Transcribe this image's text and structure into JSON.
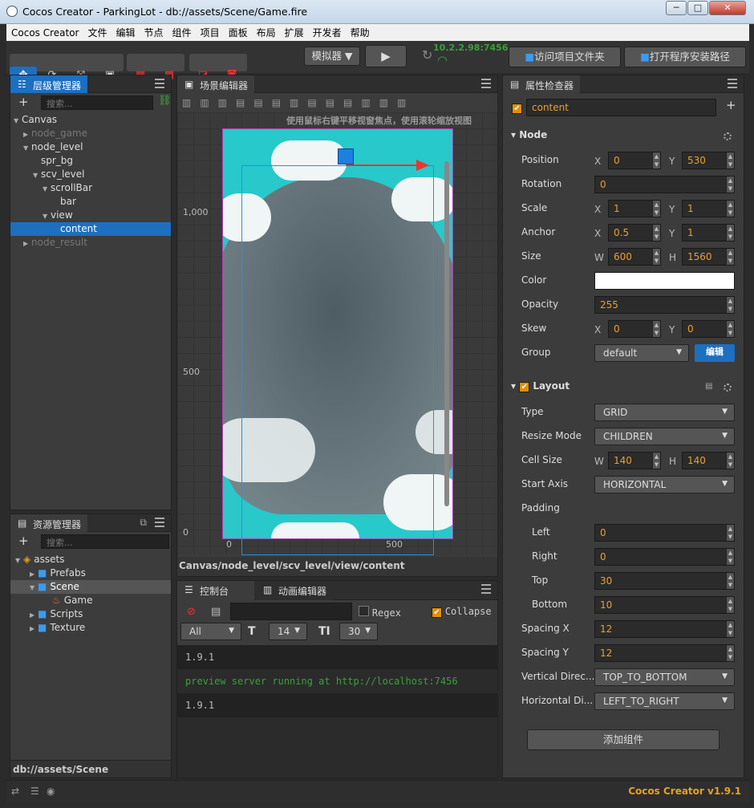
{
  "window": {
    "title": "Cocos Creator - ParkingLot - db://assets/Scene/Game.fire",
    "min": "─",
    "max": "□",
    "close": "✕"
  },
  "menu": [
    "Cocos Creator",
    "文件",
    "编辑",
    "节点",
    "组件",
    "项目",
    "面板",
    "布局",
    "扩展",
    "开发者",
    "帮助"
  ],
  "toolbar": {
    "simulator": "模拟器 ▼",
    "play": "▶",
    "refresh": "↻",
    "ip": "10.2.2.98:7456",
    "open_project": "访问项目文件夹",
    "open_install": "打开程序安装路径"
  },
  "hierarchy": {
    "tab": "层级管理器",
    "add": "+",
    "search_placeholder": "搜索...",
    "nodes": [
      {
        "label": "Canvas",
        "state": "open",
        "depth": 0,
        "dim": false,
        "selected": false
      },
      {
        "label": "node_game",
        "state": "closed",
        "depth": 1,
        "dim": true,
        "selected": false
      },
      {
        "label": "node_level",
        "state": "open",
        "depth": 1,
        "dim": false,
        "selected": false
      },
      {
        "label": "spr_bg",
        "state": "leaf",
        "depth": 2,
        "dim": false,
        "selected": false
      },
      {
        "label": "scv_level",
        "state": "open",
        "depth": 2,
        "dim": false,
        "selected": false
      },
      {
        "label": "scrollBar",
        "state": "open",
        "depth": 3,
        "dim": false,
        "selected": false
      },
      {
        "label": "bar",
        "state": "leaf",
        "depth": 4,
        "dim": false,
        "selected": false
      },
      {
        "label": "view",
        "state": "open",
        "depth": 3,
        "dim": false,
        "selected": false
      },
      {
        "label": "content",
        "state": "leaf",
        "depth": 4,
        "dim": false,
        "selected": true
      },
      {
        "label": "node_result",
        "state": "closed",
        "depth": 1,
        "dim": true,
        "selected": false
      }
    ]
  },
  "assets": {
    "tab": "资源管理器",
    "add": "+",
    "search_placeholder": "搜索...",
    "items": [
      {
        "label": "assets",
        "state": "open",
        "depth": 0,
        "icon": "assets-db-icon",
        "selected": false
      },
      {
        "label": "Prefabs",
        "state": "closed",
        "depth": 1,
        "icon": "folder-icon",
        "selected": false
      },
      {
        "label": "Scene",
        "state": "open",
        "depth": 1,
        "icon": "folder-icon",
        "selected": true
      },
      {
        "label": "Game",
        "state": "leaf",
        "depth": 2,
        "icon": "scene-fire-icon",
        "selected": false
      },
      {
        "label": "Scripts",
        "state": "closed",
        "depth": 1,
        "icon": "folder-icon",
        "selected": false
      },
      {
        "label": "Texture",
        "state": "closed",
        "depth": 1,
        "icon": "folder-icon",
        "selected": false
      }
    ],
    "path": "db://assets/Scene"
  },
  "scene": {
    "tab": "场景编辑器",
    "hint": "使用鼠标右键平移视窗焦点，使用滚轮缩放视图",
    "y_ticks": [
      "1,000",
      "500",
      "0"
    ],
    "x_ticks": [
      "0",
      "500"
    ],
    "breadcrumb": "Canvas/node_level/scv_level/view/content"
  },
  "console": {
    "tabs": [
      "控制台",
      "动画编辑器"
    ],
    "regex": "Regex",
    "collapse": "Collapse",
    "filter": "All",
    "font_size": "14",
    "line_height": "30",
    "lines": [
      {
        "text": "1.9.1",
        "color": "#bbbbbb"
      },
      {
        "text": "preview server running at http://localhost:7456",
        "color": "#3aa03a"
      },
      {
        "text": "1.9.1",
        "color": "#bbbbbb"
      }
    ]
  },
  "inspector": {
    "tab": "属性检查器",
    "name": "content",
    "add": "+",
    "node_section": "Node",
    "position": {
      "label": "Position",
      "x": "0",
      "y": "530"
    },
    "rotation": {
      "label": "Rotation",
      "value": "0"
    },
    "scale": {
      "label": "Scale",
      "x": "1",
      "y": "1"
    },
    "anchor": {
      "label": "Anchor",
      "x": "0.5",
      "y": "1"
    },
    "size": {
      "label": "Size",
      "w": "600",
      "h": "1560"
    },
    "color": {
      "label": "Color",
      "value": "#ffffff"
    },
    "opacity": {
      "label": "Opacity",
      "value": "255"
    },
    "skew": {
      "label": "Skew",
      "x": "0",
      "y": "0"
    },
    "group": {
      "label": "Group",
      "value": "default",
      "edit": "编辑"
    },
    "layout_section": "Layout",
    "type": {
      "label": "Type",
      "value": "GRID"
    },
    "resize_mode": {
      "label": "Resize Mode",
      "value": "CHILDREN"
    },
    "cell_size": {
      "label": "Cell Size",
      "w": "140",
      "h": "140"
    },
    "start_axis": {
      "label": "Start Axis",
      "value": "HORIZONTAL"
    },
    "padding": {
      "label": "Padding",
      "left_label": "Left",
      "left": "0",
      "right_label": "Right",
      "right": "0",
      "top_label": "Top",
      "top": "30",
      "bottom_label": "Bottom",
      "bottom": "10"
    },
    "spacing_x": {
      "label": "Spacing X",
      "value": "12"
    },
    "spacing_y": {
      "label": "Spacing Y",
      "value": "12"
    },
    "vertical_direction": {
      "label": "Vertical Direc...",
      "value": "TOP_TO_BOTTOM"
    },
    "horizontal_direction": {
      "label": "Horizontal Di...",
      "value": "LEFT_TO_RIGHT"
    },
    "add_component": "添加组件"
  },
  "statusbar": {
    "version": "Cocos Creator v1.9.1",
    "accent": "#e8a020"
  },
  "colors": {
    "accent_blue": "#1d6fc0",
    "field_text": "#e9a030",
    "scene_sky": "#2fc8c8",
    "scene_rock": "#5c6a70"
  }
}
